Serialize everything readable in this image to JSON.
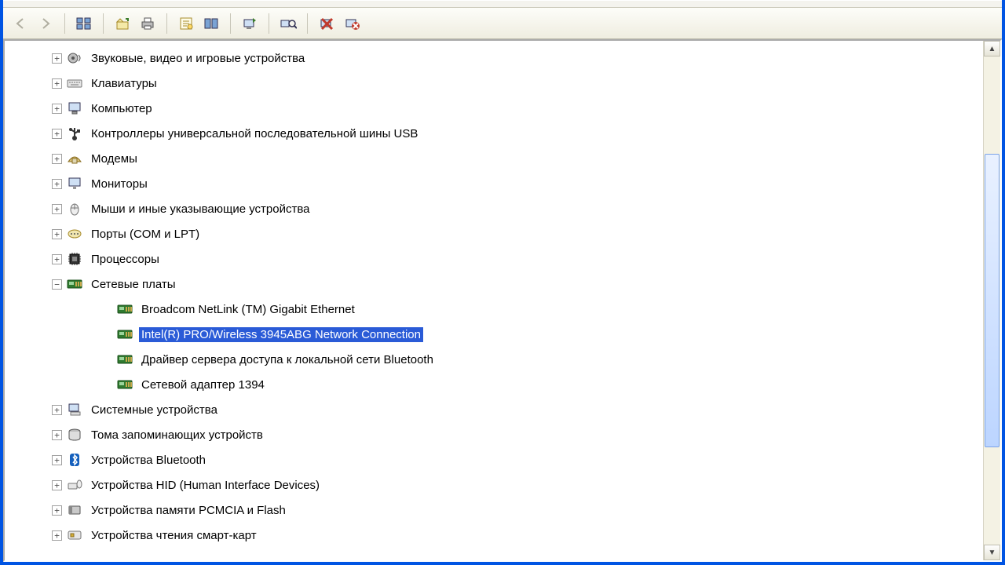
{
  "toolbar": {
    "back": "Назад",
    "forward": "Вперёд",
    "views": "Вид",
    "up": "Вверх",
    "print": "Печать",
    "props": "Свойства",
    "console": "Консоль",
    "refresh": "Обновить",
    "scan": "Обновить конфигурацию",
    "disable": "Отключить",
    "uninstall": "Удалить"
  },
  "tree": [
    {
      "label": "Звуковые, видео и игровые устройства",
      "icon": "sound-icon",
      "expanded": false,
      "level": 0
    },
    {
      "label": "Клавиатуры",
      "icon": "keyboard-icon",
      "expanded": false,
      "level": 0
    },
    {
      "label": "Компьютер",
      "icon": "computer-icon",
      "expanded": false,
      "level": 0
    },
    {
      "label": "Контроллеры универсальной последовательной шины USB",
      "icon": "usb-icon",
      "expanded": false,
      "level": 0
    },
    {
      "label": "Модемы",
      "icon": "modem-icon",
      "expanded": false,
      "level": 0
    },
    {
      "label": "Мониторы",
      "icon": "monitor-icon",
      "expanded": false,
      "level": 0
    },
    {
      "label": "Мыши и иные указывающие устройства",
      "icon": "mouse-icon",
      "expanded": false,
      "level": 0
    },
    {
      "label": "Порты (COM и LPT)",
      "icon": "port-icon",
      "expanded": false,
      "level": 0
    },
    {
      "label": "Процессоры",
      "icon": "cpu-icon",
      "expanded": false,
      "level": 0
    },
    {
      "label": "Сетевые платы",
      "icon": "nic-icon",
      "expanded": true,
      "level": 0
    },
    {
      "label": "Broadcom NetLink (TM) Gigabit Ethernet",
      "icon": "nic-icon",
      "level": 1,
      "leaf": true
    },
    {
      "label": "Intel(R) PRO/Wireless 3945ABG Network Connection",
      "icon": "nic-icon",
      "level": 1,
      "leaf": true,
      "selected": true
    },
    {
      "label": "Драйвер сервера доступа к локальной сети Bluetooth",
      "icon": "nic-icon",
      "level": 1,
      "leaf": true
    },
    {
      "label": "Сетевой адаптер 1394",
      "icon": "nic-icon",
      "level": 1,
      "leaf": true
    },
    {
      "label": "Системные устройства",
      "icon": "system-icon",
      "expanded": false,
      "level": 0
    },
    {
      "label": "Тома запоминающих устройств",
      "icon": "volume-icon",
      "expanded": false,
      "level": 0
    },
    {
      "label": "Устройства Bluetooth",
      "icon": "bluetooth-icon",
      "expanded": false,
      "level": 0
    },
    {
      "label": "Устройства HID (Human Interface Devices)",
      "icon": "hid-icon",
      "expanded": false,
      "level": 0
    },
    {
      "label": "Устройства памяти PCMCIA и Flash",
      "icon": "pcmcia-icon",
      "expanded": false,
      "level": 0
    },
    {
      "label": "Устройства чтения смарт-карт",
      "icon": "smartcard-icon",
      "expanded": false,
      "level": 0
    }
  ]
}
